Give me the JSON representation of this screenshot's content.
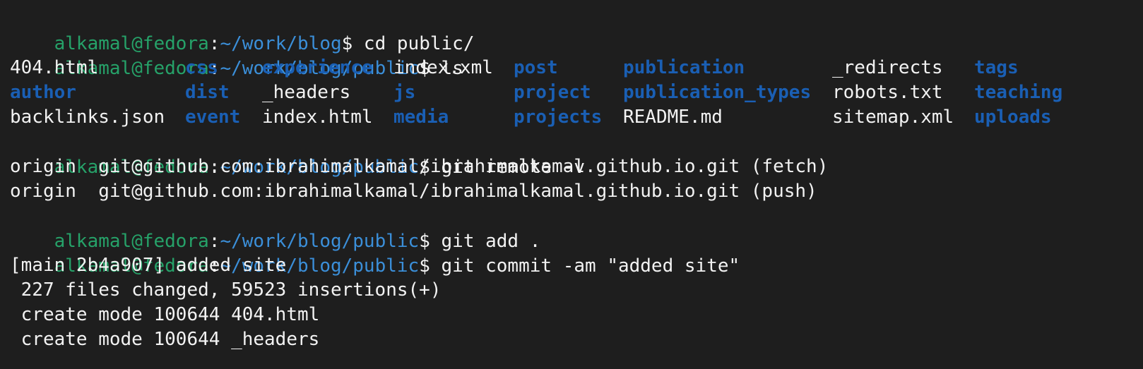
{
  "prompt": {
    "user_host": "alkamal@fedora",
    "separator": ":",
    "dollar": "$"
  },
  "lines": [
    {
      "path": "~/work/blog",
      "command": " cd public/"
    },
    {
      "path": "~/work/blog/public",
      "command": " ls"
    },
    {
      "path": "~/work/blog/public",
      "command": " git remote -v"
    },
    {
      "path": "~/work/blog/public",
      "command": " git add ."
    },
    {
      "path": "~/work/blog/public",
      "command": " git commit -am \"added site\""
    }
  ],
  "ls_grid": {
    "rows": [
      [
        {
          "name": "404.html",
          "type": "file"
        },
        {
          "name": "css",
          "type": "dir"
        },
        {
          "name": "experience",
          "type": "dir"
        },
        {
          "name": "index.xml",
          "type": "file"
        },
        {
          "name": "post",
          "type": "dir"
        },
        {
          "name": "publication",
          "type": "dir"
        },
        {
          "name": "_redirects",
          "type": "file"
        },
        {
          "name": "tags",
          "type": "dir"
        }
      ],
      [
        {
          "name": "author",
          "type": "dir"
        },
        {
          "name": "dist",
          "type": "dir"
        },
        {
          "name": "_headers",
          "type": "file"
        },
        {
          "name": "js",
          "type": "dir"
        },
        {
          "name": "project",
          "type": "dir"
        },
        {
          "name": "publication_types",
          "type": "dir"
        },
        {
          "name": "robots.txt",
          "type": "file"
        },
        {
          "name": "teaching",
          "type": "dir"
        }
      ],
      [
        {
          "name": "backlinks.json",
          "type": "file"
        },
        {
          "name": "event",
          "type": "dir"
        },
        {
          "name": "index.html",
          "type": "file"
        },
        {
          "name": "media",
          "type": "dir"
        },
        {
          "name": "projects",
          "type": "dir"
        },
        {
          "name": "README.md",
          "type": "file"
        },
        {
          "name": "sitemap.xml",
          "type": "file"
        },
        {
          "name": "uploads",
          "type": "dir"
        }
      ]
    ]
  },
  "remote_output": [
    "origin  git@github.com:ibrahimalkamal/ibrahimalkamal.github.io.git (fetch)",
    "origin  git@github.com:ibrahimalkamal/ibrahimalkamal.github.io.git (push)"
  ],
  "commit_output": [
    "[main 2b4a907] added site",
    " 227 files changed, 59523 insertions(+)",
    " create mode 100644 404.html",
    " create mode 100644 _headers"
  ],
  "colors": {
    "background": "#1e1e1e",
    "prompt_user": "#26a269",
    "prompt_path": "#3b8fd9",
    "directory": "#1a5fb4",
    "text": "#f2f2f2"
  }
}
